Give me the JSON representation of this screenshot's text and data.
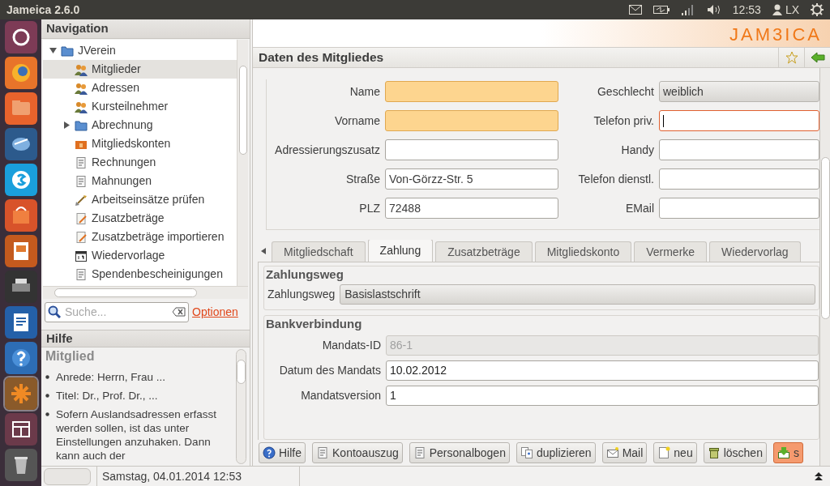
{
  "top_bar": {
    "title": "Jameica 2.6.0",
    "clock": "12:53",
    "user": "LX"
  },
  "launcher": {
    "items": [
      {
        "kind": "home"
      },
      {
        "kind": "browser"
      },
      {
        "kind": "files"
      },
      {
        "kind": "mail"
      },
      {
        "kind": "chat"
      },
      {
        "kind": "store"
      },
      {
        "kind": "slides"
      },
      {
        "kind": "printer"
      },
      {
        "kind": "writer"
      },
      {
        "kind": "help"
      },
      {
        "kind": "app",
        "selected": true
      },
      {
        "kind": "window"
      },
      {
        "kind": "trash"
      }
    ]
  },
  "navigation": {
    "title": "Navigation",
    "tree": [
      {
        "label": "JVerein",
        "expanded": true,
        "selected": false,
        "children": [
          {
            "label": "Mitglieder",
            "selected": true
          },
          {
            "label": "Adressen",
            "selected": false
          },
          {
            "label": "Kursteilnehmer",
            "selected": false
          },
          {
            "label": "Abrechnung",
            "expanded": false,
            "selected": false
          },
          {
            "label": "Mitgliedskonten",
            "selected": false
          },
          {
            "label": "Rechnungen",
            "selected": false
          },
          {
            "label": "Mahnungen",
            "selected": false
          },
          {
            "label": "Arbeitseinsätze prüfen",
            "selected": false
          },
          {
            "label": "Zusatzbeträge",
            "selected": false
          },
          {
            "label": "Zusatzbeträge importieren",
            "selected": false
          },
          {
            "label": "Wiedervorlage",
            "selected": false
          },
          {
            "label": "Spendenbescheinigungen",
            "selected": false
          }
        ]
      }
    ],
    "search": {
      "placeholder": "Suche...",
      "options_link": "Optionen"
    }
  },
  "help": {
    "title": "Hilfe",
    "heading": "Mitglied",
    "items": [
      "Anrede: Herrn, Frau ...",
      "Titel: Dr., Prof. Dr., ...",
      "Sofern Auslandsadressen erfasst werden sollen, ist das unter Einstellungen anzuhaken. Dann kann auch der"
    ]
  },
  "status_bar": {
    "text": "Samstag, 04.01.2014 12:53"
  },
  "content": {
    "logo": "JAM3ICA",
    "title": "Daten des Mitgliedes",
    "left_fields": [
      {
        "label": "Name",
        "required": true
      },
      {
        "label": "Vorname",
        "required": true
      },
      {
        "label": "Adressierungszusatz",
        "required": false
      },
      {
        "label": "Straße",
        "value": "Von-Görzz-Str. 5",
        "required": false
      },
      {
        "label": "PLZ",
        "value": "72488",
        "required": false
      }
    ],
    "right_fields": [
      {
        "label": "Geschlecht",
        "kind": "select",
        "value": "weiblich"
      },
      {
        "label": "Telefon priv.",
        "kind": "text",
        "focused": true
      },
      {
        "label": "Handy",
        "kind": "text",
        "focused": false
      },
      {
        "label": "Telefon dienstl.",
        "kind": "text",
        "focused": false
      },
      {
        "label": "EMail",
        "kind": "text",
        "focused": false
      }
    ],
    "tabs": [
      {
        "label": "Mitgliedschaft",
        "selected": false
      },
      {
        "label": "Zahlung",
        "selected": true
      },
      {
        "label": "Zusatzbeträge",
        "selected": false
      },
      {
        "label": "Mitgliedskonto",
        "selected": false
      },
      {
        "label": "Vermerke",
        "selected": false
      },
      {
        "label": "Wiedervorlag",
        "selected": false
      }
    ],
    "zahlungsweg": {
      "title": "Zahlungsweg",
      "label": "Zahlungsweg",
      "value": "Basislastschrift"
    },
    "bankverbindung": {
      "title": "Bankverbindung",
      "fields": [
        {
          "label": "Mandats-ID",
          "value": "86-1",
          "disabled": true
        },
        {
          "label": "Datum des Mandats",
          "value": "10.02.2012",
          "disabled": false
        },
        {
          "label": "Mandatsversion",
          "value": "1",
          "disabled": false
        }
      ]
    },
    "buttons": [
      {
        "label": "Hilfe",
        "kind": "normal"
      },
      {
        "label": "Kontoauszug",
        "kind": "normal"
      },
      {
        "label": "Personalbogen",
        "kind": "normal"
      },
      {
        "label": "duplizieren",
        "kind": "normal"
      },
      {
        "label": "Mail",
        "kind": "normal"
      },
      {
        "label": "neu",
        "kind": "normal"
      },
      {
        "label": "löschen",
        "kind": "normal"
      },
      {
        "label": "s",
        "kind": "primary"
      }
    ]
  }
}
